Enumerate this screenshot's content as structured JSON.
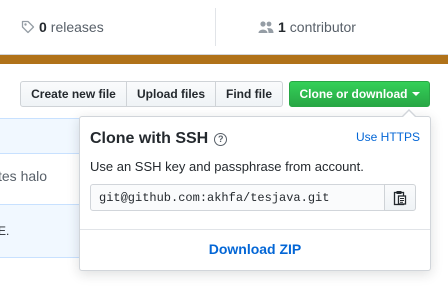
{
  "stats": {
    "releases": {
      "count": "0",
      "label": "releases",
      "icon": "tag-icon"
    },
    "contributors": {
      "count": "1",
      "label": "contributor",
      "icon": "people-icon"
    }
  },
  "language_bar": {
    "color": "#b07219"
  },
  "toolbar": {
    "create_new_file": "Create new file",
    "upload_files": "Upload files",
    "find_file": "Find file",
    "clone_or_download": "Clone or download"
  },
  "file_list": {
    "commit_message_fragment": "tes halo",
    "readme_fragment": "E."
  },
  "clone_dropdown": {
    "title": "Clone with SSH",
    "help_icon": "question-icon",
    "switch_link": "Use HTTPS",
    "description": "Use an SSH key and passphrase from account.",
    "url_value": "git@github.com:akhfa/tesjava.git",
    "copy_icon": "clipboard-icon",
    "download_zip": "Download ZIP"
  },
  "colors": {
    "primary_button": "#28a745",
    "link": "#0366d6"
  }
}
